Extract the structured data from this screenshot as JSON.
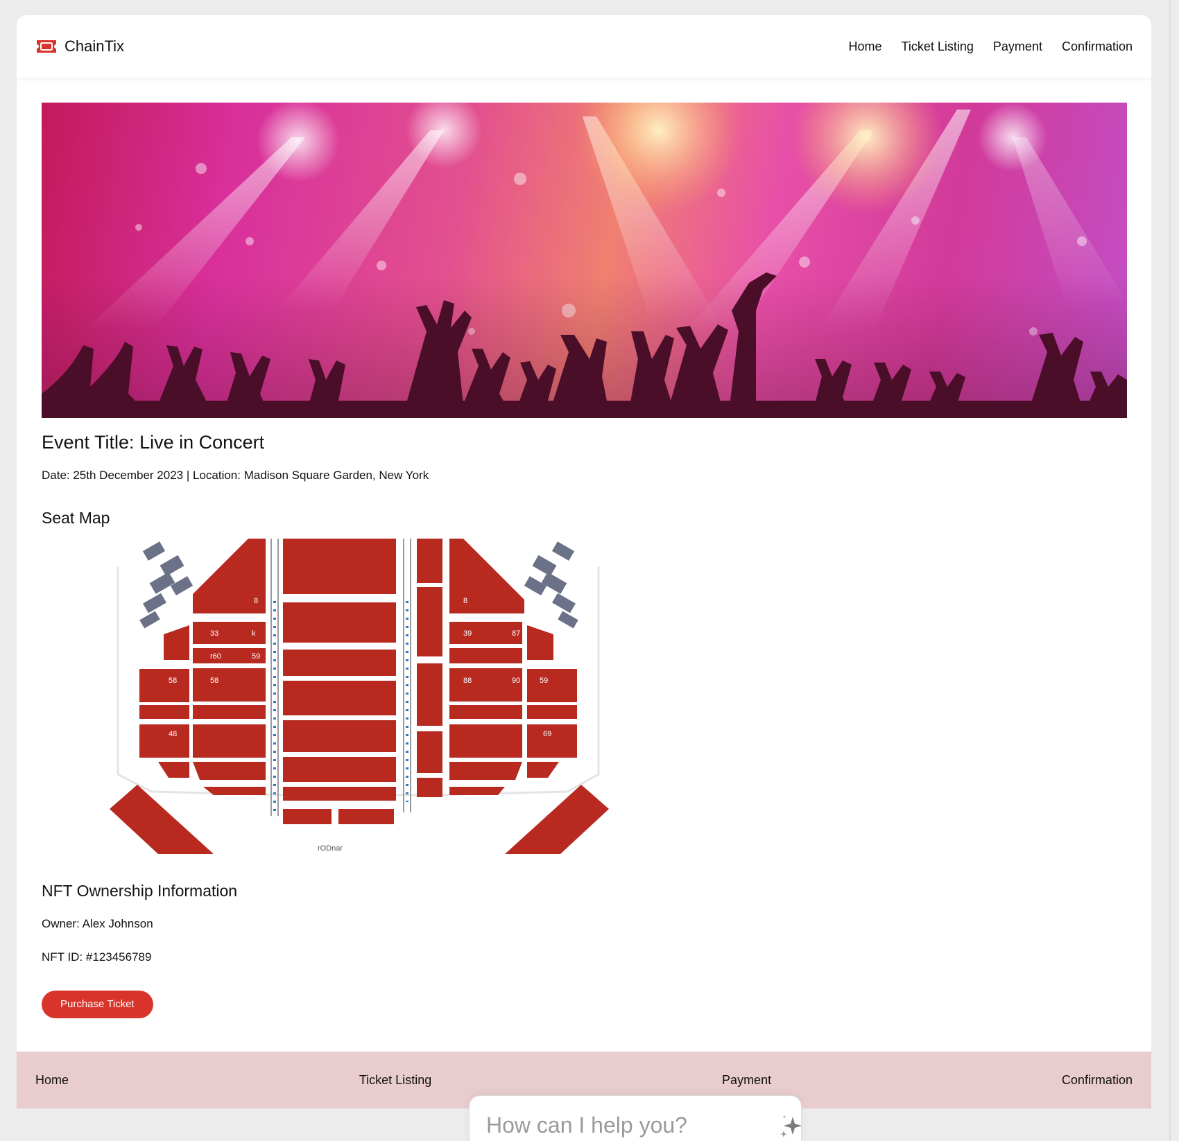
{
  "brand": {
    "name": "ChainTix",
    "icon": "ticket-icon",
    "accent": "#d9342b"
  },
  "nav": {
    "items": [
      "Home",
      "Ticket Listing",
      "Payment",
      "Confirmation"
    ]
  },
  "hero": {
    "image": "concert-crowd-stage-lights"
  },
  "event": {
    "title": "Event Title: Live in Concert",
    "meta": "Date: 25th December 2023 | Location: Madison Square Garden, New York"
  },
  "seatmap": {
    "heading": "Seat Map",
    "image": "venue-seat-map"
  },
  "nft": {
    "heading": "NFT Ownership Information",
    "owner": "Owner: Alex Johnson",
    "id": "NFT ID: #123456789"
  },
  "actions": {
    "purchase": "Purchase Ticket"
  },
  "footer": {
    "items": [
      "Home",
      "Ticket Listing",
      "Payment",
      "Confirmation"
    ],
    "background": "#e9cdce"
  },
  "assistant": {
    "placeholder": "How can I help you?",
    "icon": "sparkle-icon"
  }
}
